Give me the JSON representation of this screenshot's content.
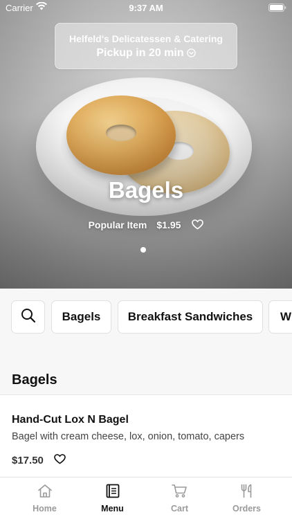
{
  "status_bar": {
    "carrier": "Carrier",
    "time": "9:37 AM"
  },
  "store": {
    "name": "Helfeld's Delicatessen & Catering",
    "pickup": "Pickup in 20 min"
  },
  "hero": {
    "title": "Bagels",
    "subtitle": "Popular Item",
    "price": "$1.95",
    "carousel": {
      "page_count": 1,
      "current_page": 1
    }
  },
  "categories": {
    "search_icon": "search-icon",
    "items": [
      {
        "label": "Bagels"
      },
      {
        "label": "Breakfast Sandwiches"
      },
      {
        "label": "W"
      }
    ]
  },
  "section": {
    "title": "Bagels",
    "items": [
      {
        "name": "Hand-Cut Lox N Bagel",
        "description": "Bagel with cream cheese, lox, onion, tomato, capers",
        "price": "$17.50"
      }
    ]
  },
  "tab_bar": {
    "active": "Menu",
    "tabs": [
      {
        "label": "Home",
        "icon": "home-icon"
      },
      {
        "label": "Menu",
        "icon": "menu-icon"
      },
      {
        "label": "Cart",
        "icon": "cart-icon"
      },
      {
        "label": "Orders",
        "icon": "fork-knife-icon"
      }
    ]
  },
  "colors": {
    "text": "#111111",
    "inactive_tab": "#9a9a9a",
    "background": "#f7f7f7"
  }
}
